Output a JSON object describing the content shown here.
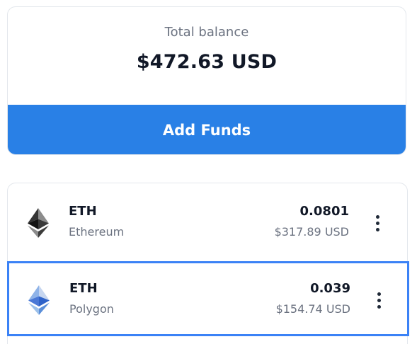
{
  "balance": {
    "label": "Total balance",
    "amount": "$472.63 USD",
    "add_funds_label": "Add Funds"
  },
  "colors": {
    "accent": "#2980e6",
    "selected_border": "#3b82f6",
    "primary_text": "#111827",
    "secondary_text": "#6b7280"
  },
  "assets": [
    {
      "symbol": "ETH",
      "network": "Ethereum",
      "amount": "0.0801",
      "value": "$317.89 USD",
      "icon": "ethereum-icon",
      "selected": false
    },
    {
      "symbol": "ETH",
      "network": "Polygon",
      "amount": "0.039",
      "value": "$154.74 USD",
      "icon": "ethereum-polygon-icon",
      "selected": true
    }
  ]
}
